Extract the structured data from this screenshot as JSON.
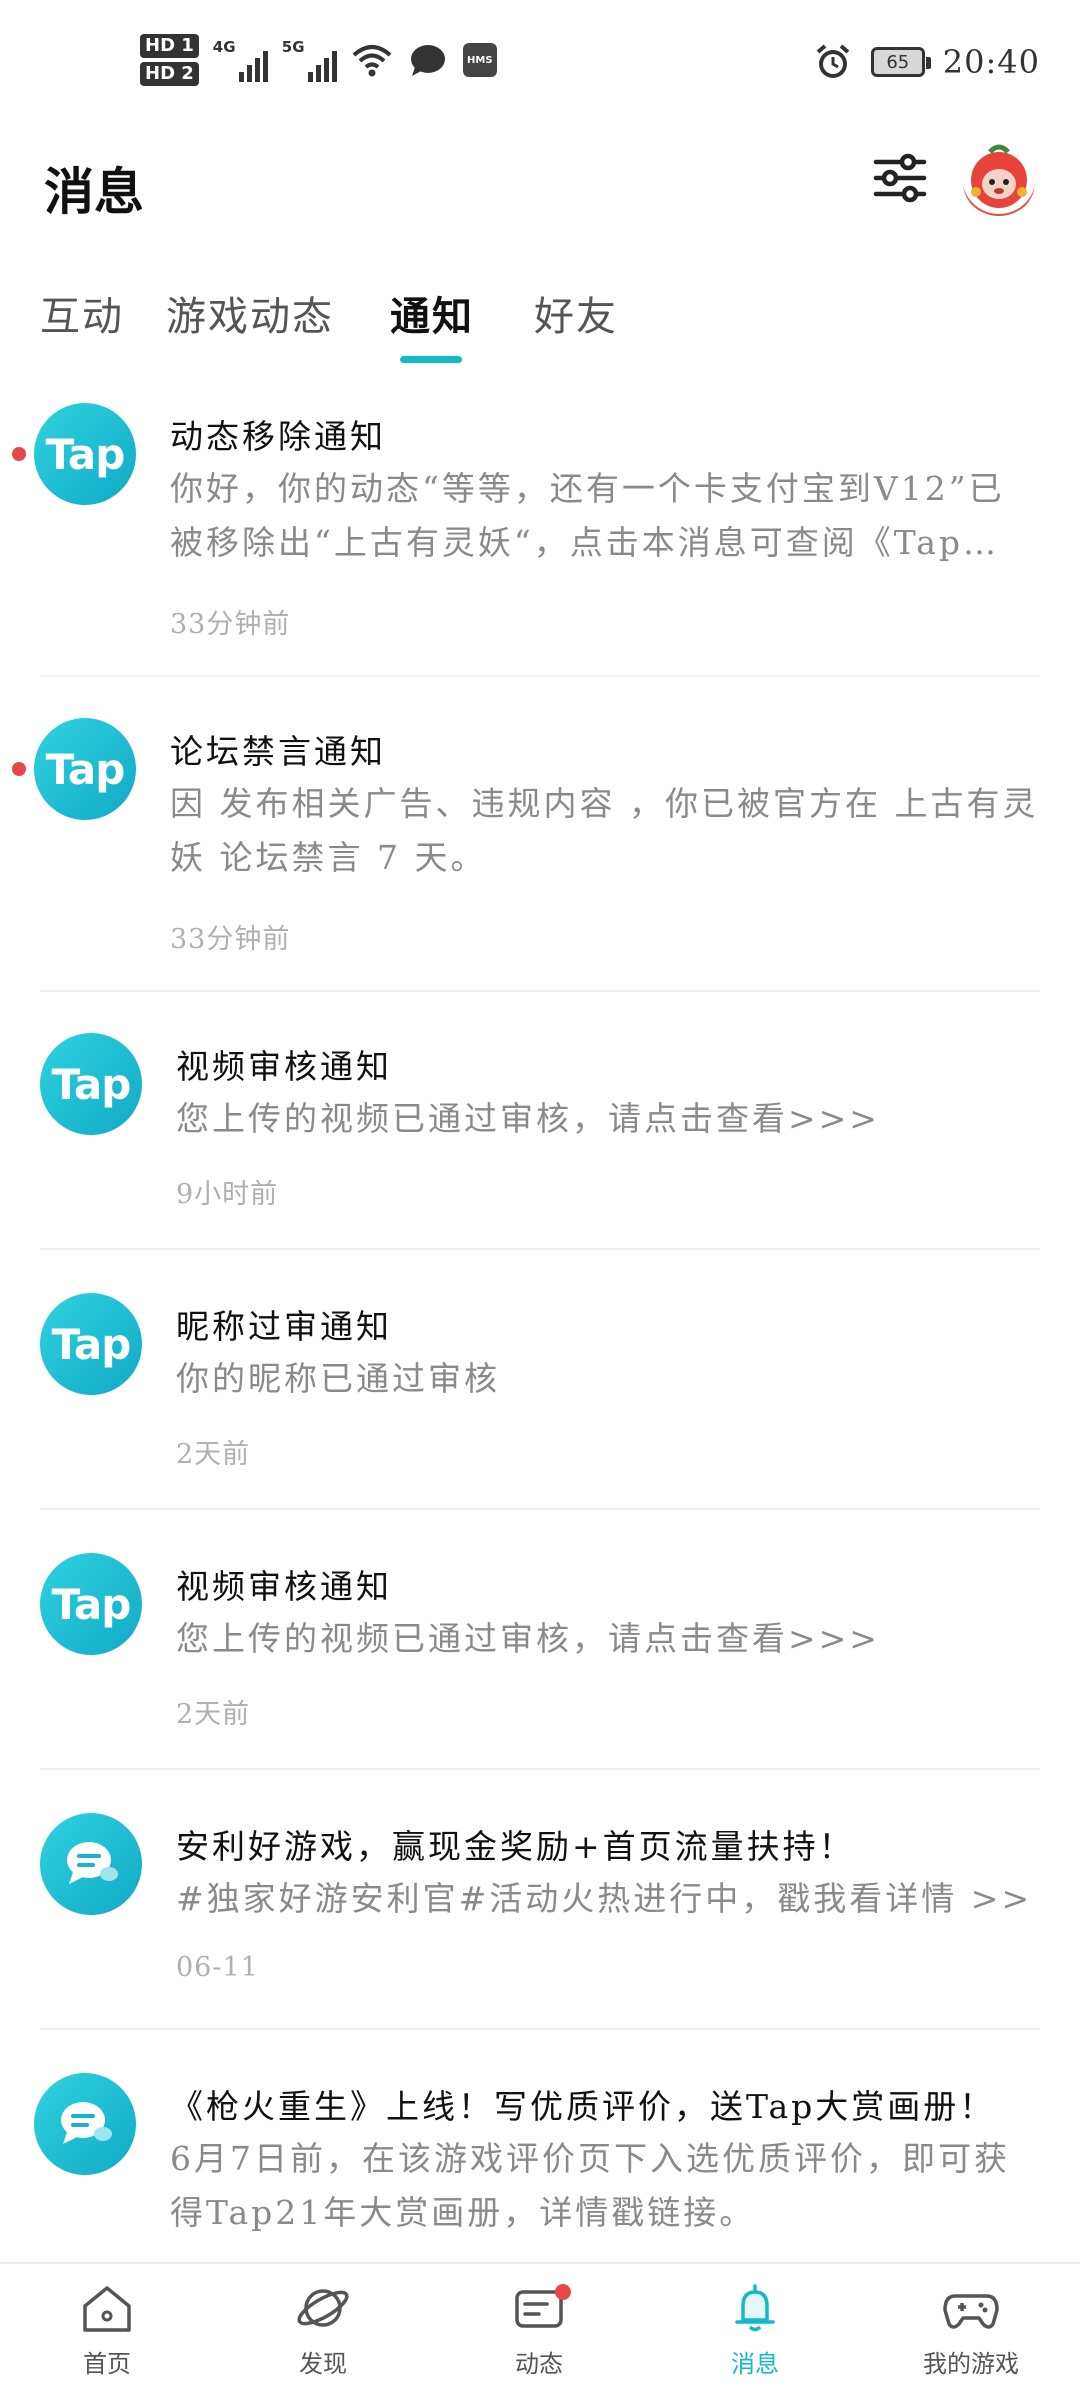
{
  "status_bar": {
    "hd1": "HD 1",
    "hd2": "HD 2",
    "net1": "4G",
    "net2": "5G",
    "hms": "HMS",
    "battery": "65",
    "time": "20:40"
  },
  "header": {
    "title": "消息"
  },
  "tabs": [
    {
      "label": "互动"
    },
    {
      "label": "游戏动态"
    },
    {
      "label": "通知"
    },
    {
      "label": "好友"
    }
  ],
  "notifications": [
    {
      "logo": "Tap",
      "title": "动态移除通知",
      "body": "你好，你的动态“等等，还有一个卡支付宝到V12”已被移除出“上古有灵妖“，点击本消息可查阅《Tap…",
      "time": "33分钟前"
    },
    {
      "logo": "Tap",
      "title": "论坛禁言通知",
      "body": "因 发布相关广告、违规内容 ，你已被官方在 上古有灵妖 论坛禁言 7 天。",
      "time": "33分钟前"
    },
    {
      "logo": "Tap",
      "title": "视频审核通知",
      "body": "您上传的视频已通过审核，请点击查看>>>",
      "time": "9小时前"
    },
    {
      "logo": "Tap",
      "title": "昵称过审通知",
      "body": "你的昵称已通过审核",
      "time": "2天前"
    },
    {
      "logo": "Tap",
      "title": "视频审核通知",
      "body": "您上传的视频已通过审核，请点击查看>>>",
      "time": "2天前"
    },
    {
      "title": "安利好游戏，赢现金奖励+首页流量扶持！",
      "body": "#独家好游安利官#活动火热进行中，戳我看详情 >>",
      "time": "06-11"
    },
    {
      "title": "《枪火重生》上线！写优质评价，送Tap大赏画册！",
      "body": "6月7日前，在该游戏评价页下入选优质评价，即可获得Tap21年大赏画册，详情戳链接。"
    }
  ],
  "bottom_nav": [
    {
      "label": "首页"
    },
    {
      "label": "发现"
    },
    {
      "label": "动态"
    },
    {
      "label": "消息"
    },
    {
      "label": "我的游戏"
    }
  ],
  "colors": {
    "accent": "#14b9c8",
    "unread": "#e54848"
  }
}
